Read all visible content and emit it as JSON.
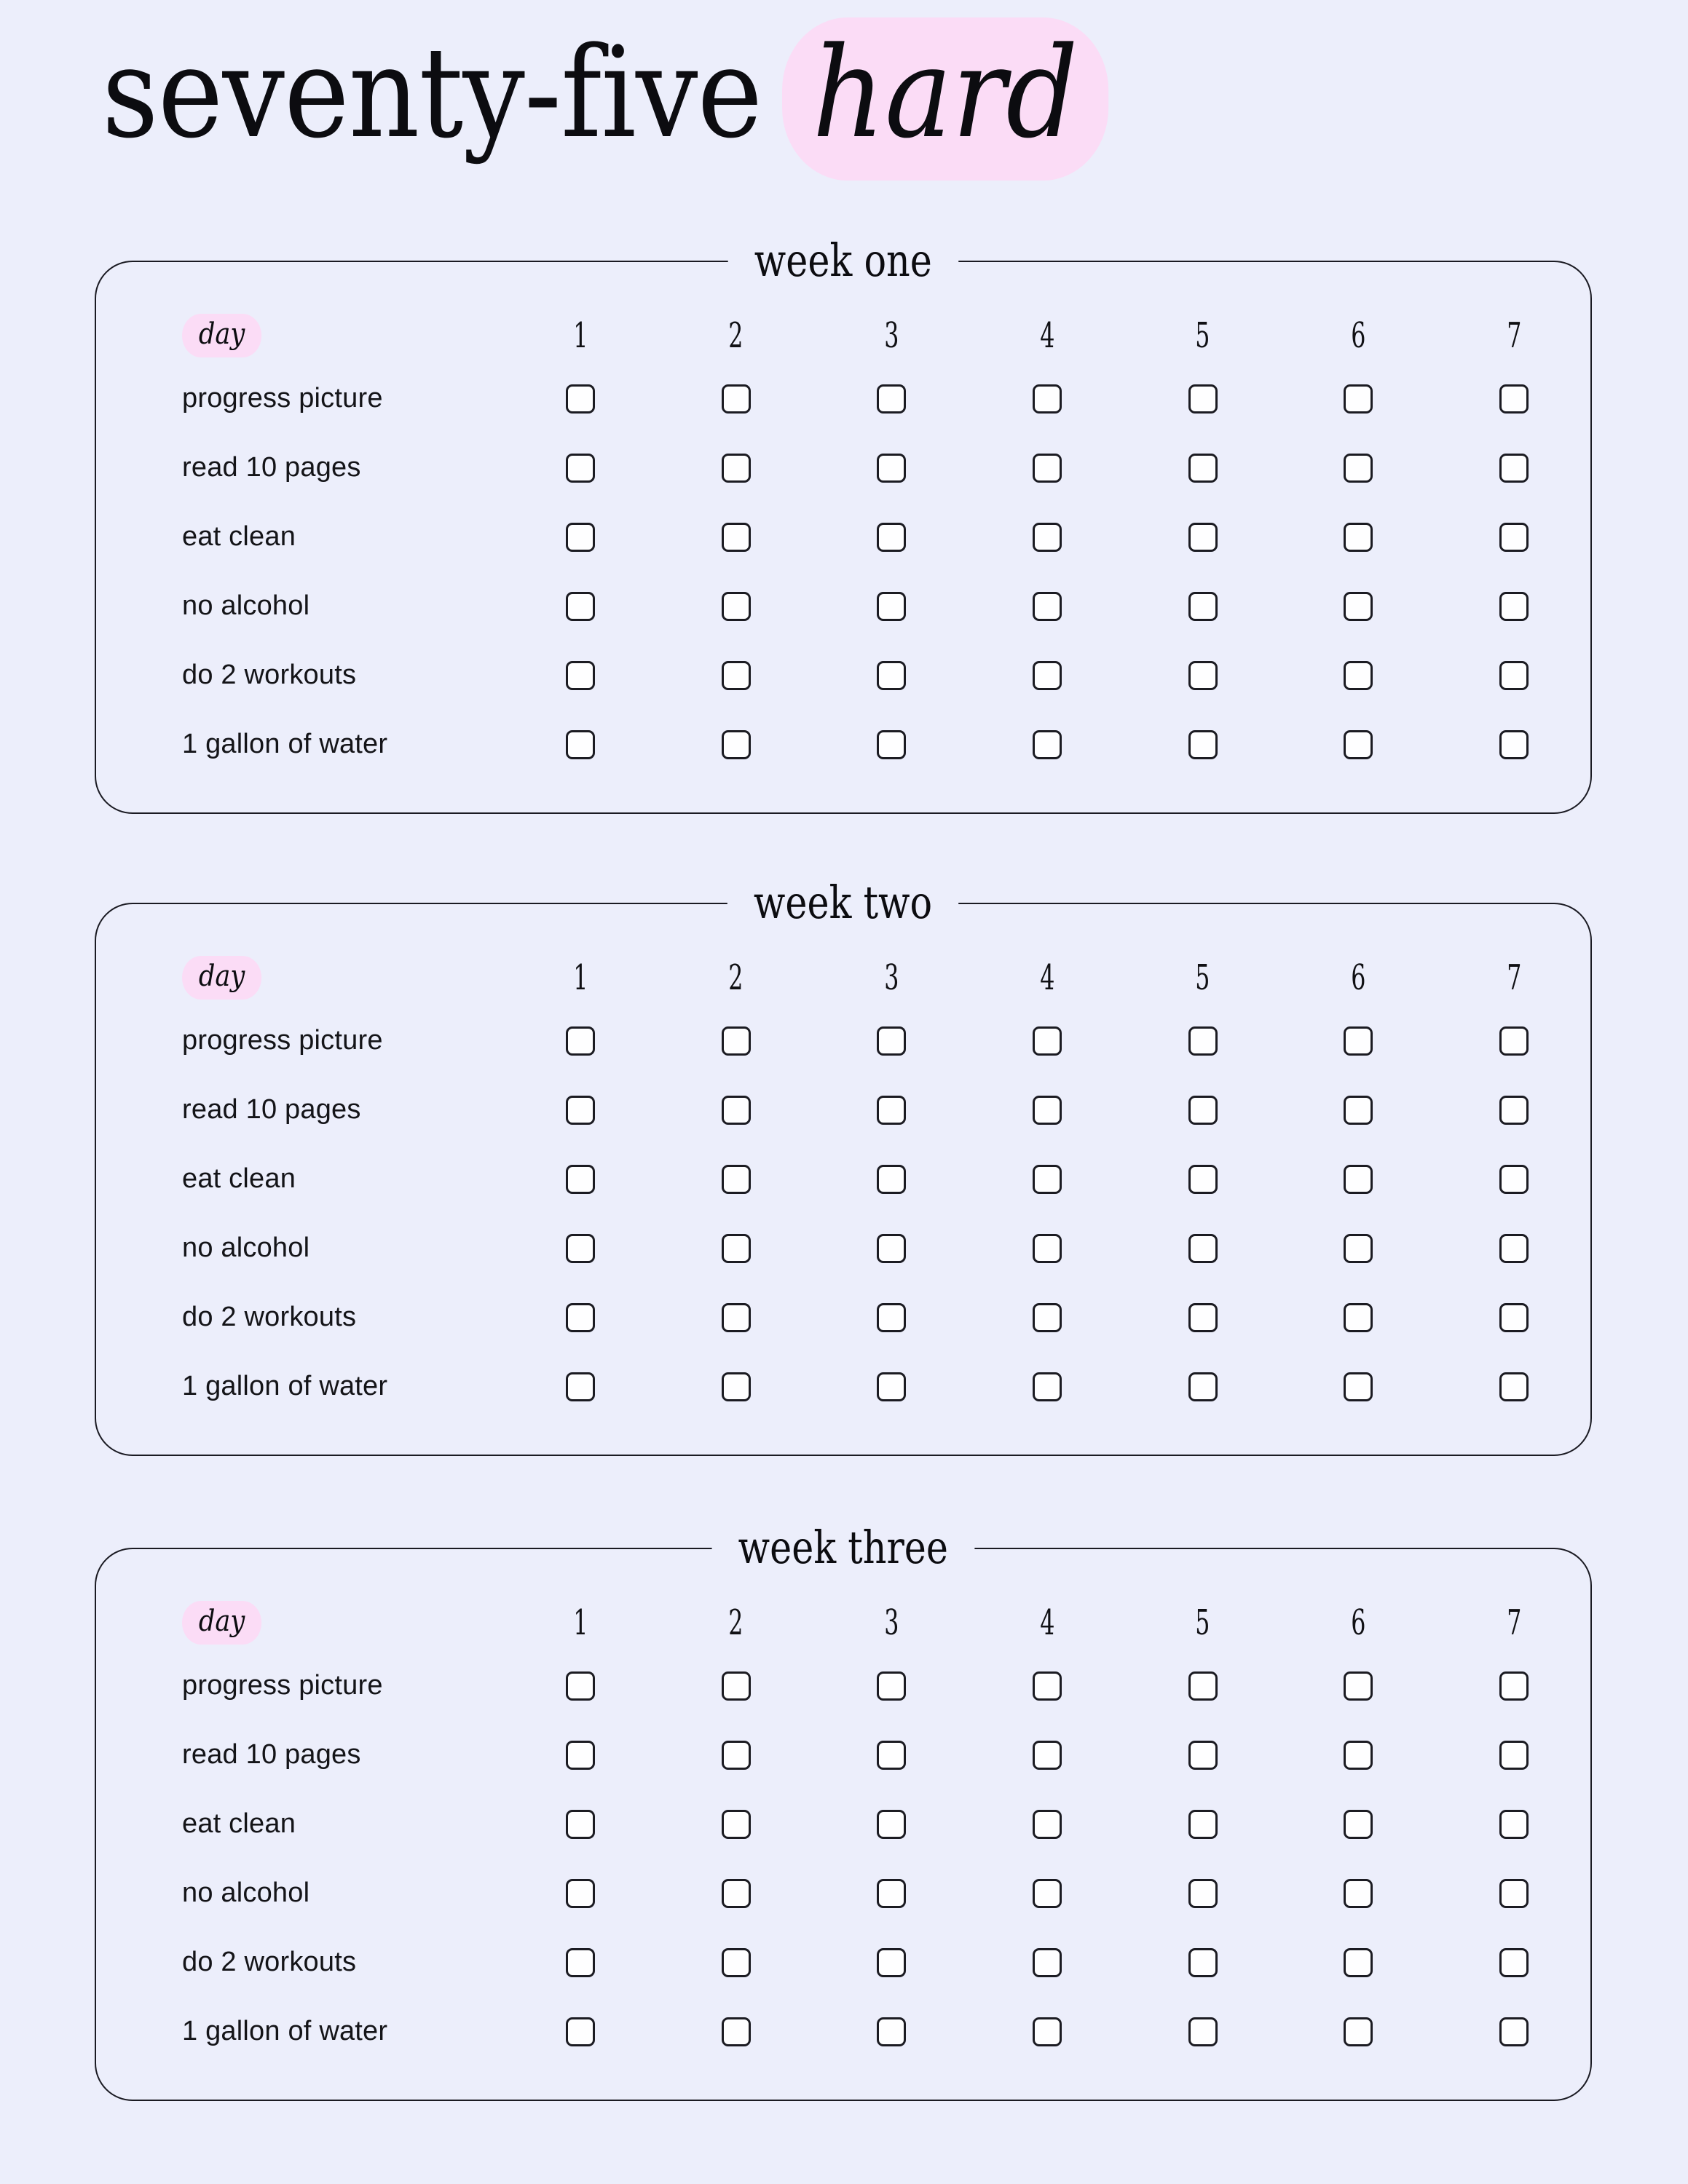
{
  "title": {
    "main": "seventy-five",
    "accent": "hard",
    "accent_bg": "#FBDCF6"
  },
  "colors": {
    "page_background": "#ECEEFB",
    "ink": "#0C0C10",
    "pink": "#FBDCF6",
    "card_border": "#1A1A22",
    "checkbox_fill": "#FEFEFF"
  },
  "day_label": "day",
  "days": [
    "1",
    "2",
    "3",
    "4",
    "5",
    "6",
    "7"
  ],
  "tasks": [
    "progress picture",
    "read 10 pages",
    "eat clean",
    "no alcohol",
    "do 2 workouts",
    "1 gallon of water"
  ],
  "weeks": [
    {
      "title": "week one"
    },
    {
      "title": "week two"
    },
    {
      "title": "week three"
    }
  ]
}
